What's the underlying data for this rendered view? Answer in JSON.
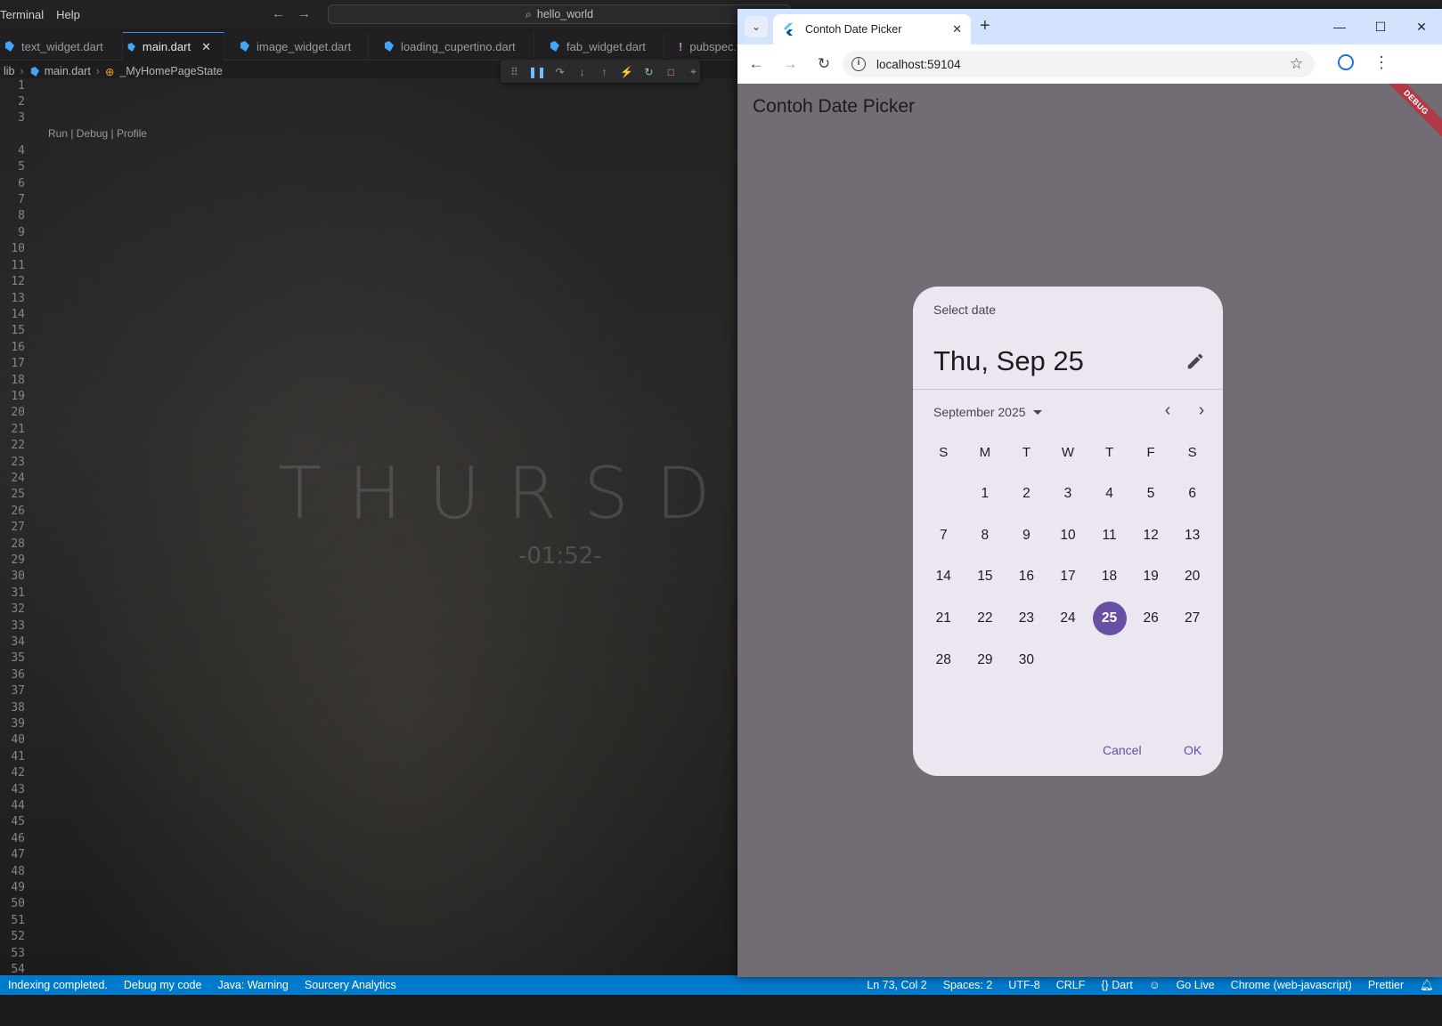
{
  "vscode": {
    "menu": [
      "Terminal",
      "Help"
    ],
    "search_text": "hello_world",
    "tabs": [
      {
        "label": "text_widget.dart",
        "active": false
      },
      {
        "label": "main.dart",
        "active": true
      },
      {
        "label": "image_widget.dart",
        "active": false
      },
      {
        "label": "loading_cupertino.dart",
        "active": false
      },
      {
        "label": "fab_widget.dart",
        "active": false
      },
      {
        "label": "pubspec.y",
        "active": false
      }
    ],
    "breadcrumb": [
      "lib",
      "main.dart",
      "_MyHomePageState"
    ],
    "codelens": "Run | Debug | Profile",
    "wallpaper": {
      "text": "THURSDA",
      "clock": "-01:52-"
    },
    "line_numbers": [
      "1",
      "2",
      "3",
      "4",
      "5",
      "6",
      "7",
      "8",
      "9",
      "10",
      "11",
      "12",
      "13",
      "14",
      "15",
      "16",
      "17",
      "18",
      "19",
      "20",
      "21",
      "22",
      "23",
      "24",
      "25",
      "26",
      "27",
      "28",
      "29",
      "30",
      "31",
      "32",
      "33",
      "34",
      "35",
      "36",
      "37",
      "38",
      "39",
      "40",
      "41",
      "42",
      "43",
      "44",
      "45",
      "46",
      "47",
      "48",
      "49",
      "50",
      "51",
      "52",
      "53",
      "54"
    ],
    "status": {
      "left": [
        "Indexing completed.",
        "Debug my code",
        "Java: Warning",
        "Sourcery Analytics"
      ],
      "right": [
        "Ln 73, Col 2",
        "Spaces: 2",
        "UTF-8",
        "CRLF",
        "{} Dart",
        "Go Live",
        "Chrome (web-javascript)",
        "Prettier"
      ]
    }
  },
  "chrome": {
    "tab_title": "Contoh Date Picker",
    "url": "localhost:59104",
    "app": {
      "title": "Contoh Date Picker",
      "debug_banner": "DEBUG"
    },
    "dialog": {
      "header": "Select date",
      "selected_date_text": "Thu, Sep 25",
      "month_label": "September 2025",
      "weekdays": [
        "S",
        "M",
        "T",
        "W",
        "T",
        "F",
        "S"
      ],
      "weeks": [
        [
          "",
          "1",
          "2",
          "3",
          "4",
          "5",
          "6"
        ],
        [
          "7",
          "8",
          "9",
          "10",
          "11",
          "12",
          "13"
        ],
        [
          "14",
          "15",
          "16",
          "17",
          "18",
          "19",
          "20"
        ],
        [
          "21",
          "22",
          "23",
          "24",
          "25",
          "26",
          "27"
        ],
        [
          "28",
          "29",
          "30",
          "",
          "",
          "",
          ""
        ]
      ],
      "selected_day": "25",
      "cancel_label": "Cancel",
      "ok_label": "OK",
      "accent_color": "#6750a4"
    }
  }
}
